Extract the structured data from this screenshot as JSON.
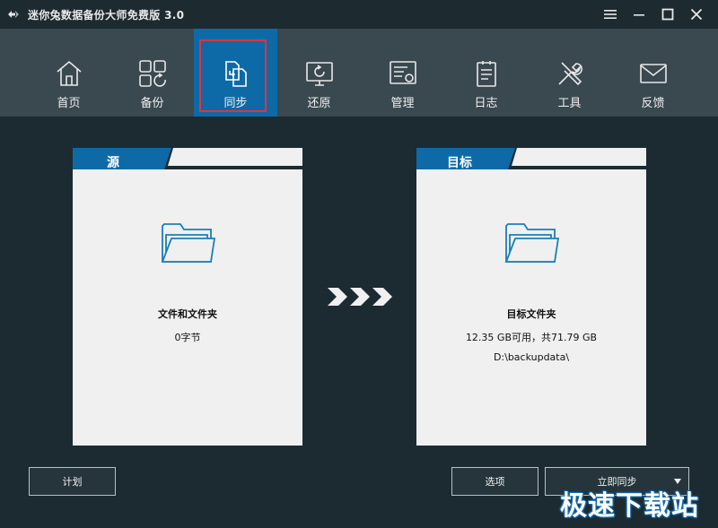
{
  "window": {
    "title": "迷你兔数据备份大师免费版 3.0",
    "logo_icon": "minitool-logo-icon"
  },
  "nav": {
    "active_index": 2,
    "items": [
      {
        "label": "首页",
        "icon": "home-icon"
      },
      {
        "label": "备份",
        "icon": "backup-icon"
      },
      {
        "label": "同步",
        "icon": "sync-icon"
      },
      {
        "label": "还原",
        "icon": "restore-icon"
      },
      {
        "label": "管理",
        "icon": "manage-icon"
      },
      {
        "label": "日志",
        "icon": "log-icon"
      },
      {
        "label": "工具",
        "icon": "tools-icon"
      },
      {
        "label": "反馈",
        "icon": "feedback-icon"
      }
    ]
  },
  "source": {
    "header": "源",
    "title": "文件和文件夹",
    "size": "0字节"
  },
  "target": {
    "header": "目标",
    "title": "目标文件夹",
    "space": "12.35 GB可用，共71.79 GB",
    "path": "D:\\backupdata\\"
  },
  "buttons": {
    "schedule": "计划",
    "options": "选项",
    "sync_now": "立即同步"
  },
  "watermark": "极速下载站",
  "colors": {
    "accent": "#0e6aa6",
    "highlight_box": "#e0333a",
    "folder": "#1a7fb5"
  }
}
